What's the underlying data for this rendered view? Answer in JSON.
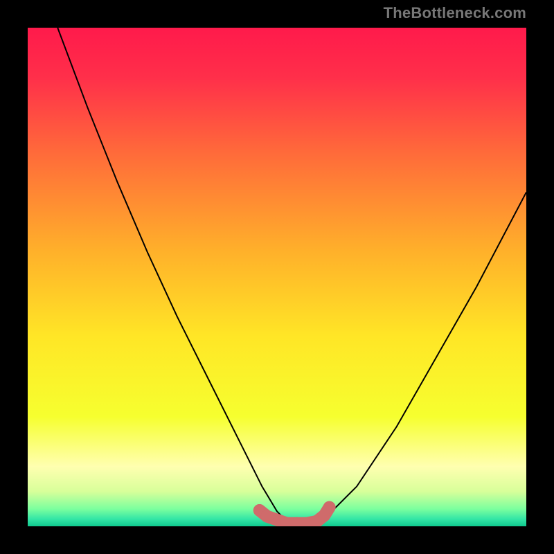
{
  "watermark": "TheBottleneck.com",
  "colors": {
    "frame": "#000000",
    "curve": "#000000",
    "marker": "#cf6b6b",
    "gradient_stops": [
      {
        "offset": 0.0,
        "color": "#ff1a4b"
      },
      {
        "offset": 0.1,
        "color": "#ff2f4a"
      },
      {
        "offset": 0.25,
        "color": "#ff6a3a"
      },
      {
        "offset": 0.45,
        "color": "#ffb12a"
      },
      {
        "offset": 0.62,
        "color": "#ffe626"
      },
      {
        "offset": 0.78,
        "color": "#f6ff2f"
      },
      {
        "offset": 0.88,
        "color": "#ffffb0"
      },
      {
        "offset": 0.93,
        "color": "#d8ff9a"
      },
      {
        "offset": 0.965,
        "color": "#7cff9e"
      },
      {
        "offset": 0.985,
        "color": "#35e6a6"
      },
      {
        "offset": 1.0,
        "color": "#0fc98f"
      }
    ]
  },
  "chart_data": {
    "type": "line",
    "title": "",
    "xlabel": "",
    "ylabel": "",
    "xlim": [
      0,
      100
    ],
    "ylim": [
      0,
      100
    ],
    "x": [
      6,
      12,
      18,
      24,
      30,
      36,
      40,
      44,
      47,
      50,
      53,
      56,
      60,
      66,
      74,
      82,
      90,
      100
    ],
    "values": [
      100,
      84,
      69,
      55,
      42,
      30,
      22,
      14,
      8,
      3,
      0,
      0,
      2,
      8,
      20,
      34,
      48,
      67
    ],
    "flat_region_x": [
      47,
      60
    ],
    "marker_x": [
      46.5,
      48,
      52,
      54,
      56,
      58,
      59.5,
      60.5
    ],
    "marker_y": [
      3.2,
      2.0,
      0.6,
      0.6,
      0.6,
      1.0,
      2.2,
      3.8
    ]
  }
}
